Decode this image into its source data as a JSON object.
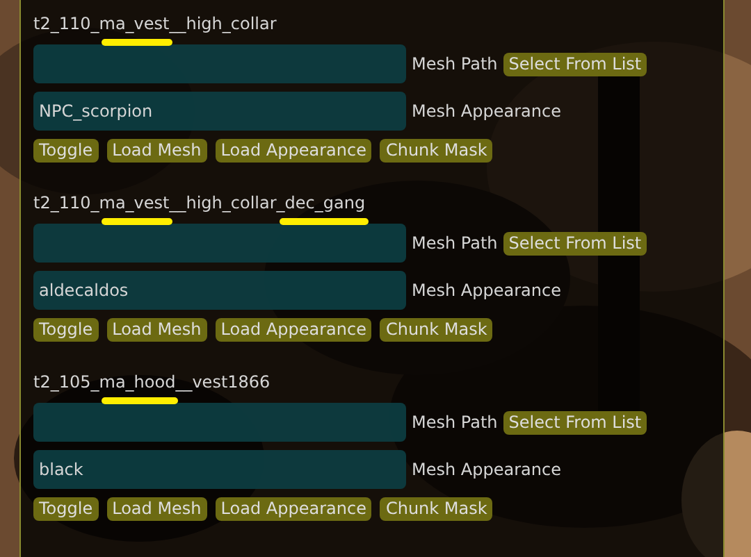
{
  "entries": [
    {
      "title": [
        {
          "text": "t2_110_",
          "marked": false
        },
        {
          "text": "ma_vest",
          "marked": true
        },
        {
          "text": "__high_collar",
          "marked": false
        }
      ],
      "mesh_path": {
        "label": "Mesh Path",
        "button": "Select From List"
      },
      "mesh_appearance": {
        "value": "NPC_scorpion",
        "label": "Mesh Appearance"
      },
      "buttons": [
        "Toggle",
        "Load Mesh",
        "Load Appearance",
        "Chunk Mask"
      ]
    },
    {
      "title": [
        {
          "text": "t2_110_",
          "marked": false
        },
        {
          "text": "ma_vest",
          "marked": true
        },
        {
          "text": "__high_collar",
          "marked": false
        },
        {
          "text": "_dec_gang",
          "marked": true
        }
      ],
      "mesh_path": {
        "label": "Mesh Path",
        "button": "Select From List"
      },
      "mesh_appearance": {
        "value": "aldecaldos",
        "label": "Mesh Appearance"
      },
      "buttons": [
        "Toggle",
        "Load Mesh",
        "Load Appearance",
        "Chunk Mask"
      ]
    },
    {
      "title": [
        {
          "text": "t2_105_",
          "marked": false
        },
        {
          "text": "ma_hood",
          "marked": true
        },
        {
          "text": "__vest1866",
          "marked": false
        }
      ],
      "mesh_path": {
        "label": "Mesh Path",
        "button": "Select From List"
      },
      "mesh_appearance": {
        "value": "black",
        "label": "Mesh Appearance"
      },
      "buttons": [
        "Toggle",
        "Load Mesh",
        "Load Appearance",
        "Chunk Mask"
      ]
    }
  ]
}
